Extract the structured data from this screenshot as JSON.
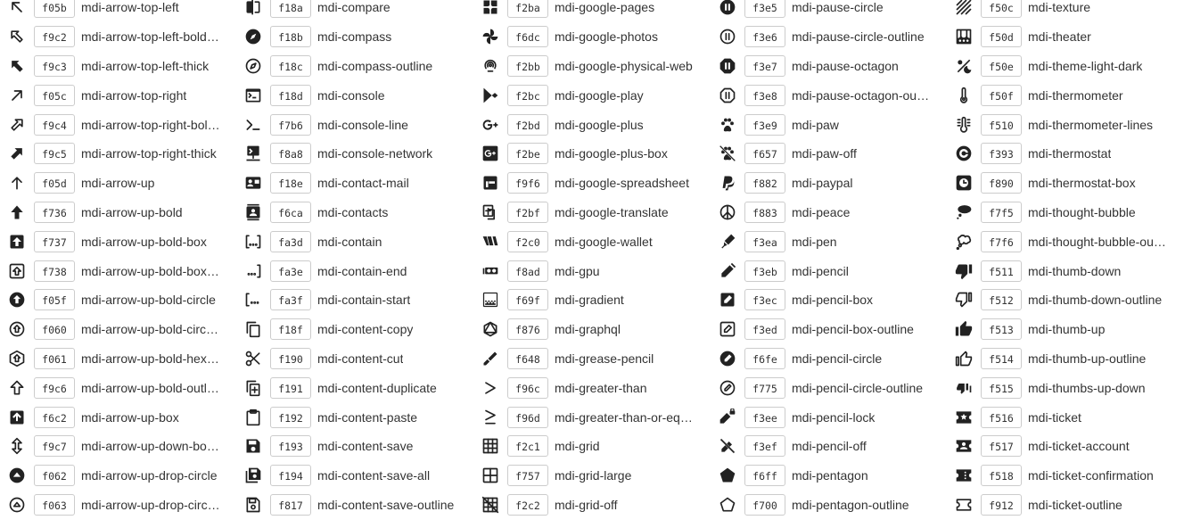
{
  "columns": [
    [
      {
        "icon": "arrow-top-left",
        "code": "f05b",
        "name": "mdi-arrow-top-left"
      },
      {
        "icon": "arrow-top-left-bold-outline",
        "code": "f9c2",
        "name": "mdi-arrow-top-left-bold…"
      },
      {
        "icon": "arrow-top-left-thick",
        "code": "f9c3",
        "name": "mdi-arrow-top-left-thick"
      },
      {
        "icon": "arrow-top-right",
        "code": "f05c",
        "name": "mdi-arrow-top-right"
      },
      {
        "icon": "arrow-top-right-bold-outline",
        "code": "f9c4",
        "name": "mdi-arrow-top-right-bol…"
      },
      {
        "icon": "arrow-top-right-thick",
        "code": "f9c5",
        "name": "mdi-arrow-top-right-thick"
      },
      {
        "icon": "arrow-up",
        "code": "f05d",
        "name": "mdi-arrow-up"
      },
      {
        "icon": "arrow-up-bold",
        "code": "f736",
        "name": "mdi-arrow-up-bold"
      },
      {
        "icon": "arrow-up-bold-box",
        "code": "f737",
        "name": "mdi-arrow-up-bold-box"
      },
      {
        "icon": "arrow-up-bold-box-outline",
        "code": "f738",
        "name": "mdi-arrow-up-bold-box…"
      },
      {
        "icon": "arrow-up-bold-circle",
        "code": "f05f",
        "name": "mdi-arrow-up-bold-circle"
      },
      {
        "icon": "arrow-up-bold-circle-outline",
        "code": "f060",
        "name": "mdi-arrow-up-bold-circ…"
      },
      {
        "icon": "arrow-up-bold-hexagon",
        "code": "f061",
        "name": "mdi-arrow-up-bold-hex…"
      },
      {
        "icon": "arrow-up-bold-outline",
        "code": "f9c6",
        "name": "mdi-arrow-up-bold-outl…"
      },
      {
        "icon": "arrow-up-box",
        "code": "f6c2",
        "name": "mdi-arrow-up-box"
      },
      {
        "icon": "arrow-up-down-bold",
        "code": "f9c7",
        "name": "mdi-arrow-up-down-bo…"
      },
      {
        "icon": "arrow-up-drop-circle",
        "code": "f062",
        "name": "mdi-arrow-up-drop-circle"
      },
      {
        "icon": "arrow-up-drop-circle-outline",
        "code": "f063",
        "name": "mdi-arrow-up-drop-circ…"
      }
    ],
    [
      {
        "icon": "compare",
        "code": "f18a",
        "name": "mdi-compare"
      },
      {
        "icon": "compass",
        "code": "f18b",
        "name": "mdi-compass"
      },
      {
        "icon": "compass-outline",
        "code": "f18c",
        "name": "mdi-compass-outline"
      },
      {
        "icon": "console",
        "code": "f18d",
        "name": "mdi-console"
      },
      {
        "icon": "console-line",
        "code": "f7b6",
        "name": "mdi-console-line"
      },
      {
        "icon": "console-network",
        "code": "f8a8",
        "name": "mdi-console-network"
      },
      {
        "icon": "contact-mail",
        "code": "f18e",
        "name": "mdi-contact-mail"
      },
      {
        "icon": "contacts",
        "code": "f6ca",
        "name": "mdi-contacts"
      },
      {
        "icon": "contain",
        "code": "fa3d",
        "name": "mdi-contain"
      },
      {
        "icon": "contain-end",
        "code": "fa3e",
        "name": "mdi-contain-end"
      },
      {
        "icon": "contain-start",
        "code": "fa3f",
        "name": "mdi-contain-start"
      },
      {
        "icon": "content-copy",
        "code": "f18f",
        "name": "mdi-content-copy"
      },
      {
        "icon": "content-cut",
        "code": "f190",
        "name": "mdi-content-cut"
      },
      {
        "icon": "content-duplicate",
        "code": "f191",
        "name": "mdi-content-duplicate"
      },
      {
        "icon": "content-paste",
        "code": "f192",
        "name": "mdi-content-paste"
      },
      {
        "icon": "content-save",
        "code": "f193",
        "name": "mdi-content-save"
      },
      {
        "icon": "content-save-all",
        "code": "f194",
        "name": "mdi-content-save-all"
      },
      {
        "icon": "content-save-outline",
        "code": "f817",
        "name": "mdi-content-save-outline"
      }
    ],
    [
      {
        "icon": "google-pages",
        "code": "f2ba",
        "name": "mdi-google-pages"
      },
      {
        "icon": "google-photos",
        "code": "f6dc",
        "name": "mdi-google-photos"
      },
      {
        "icon": "google-physical-web",
        "code": "f2bb",
        "name": "mdi-google-physical-web"
      },
      {
        "icon": "google-play",
        "code": "f2bc",
        "name": "mdi-google-play"
      },
      {
        "icon": "google-plus",
        "code": "f2bd",
        "name": "mdi-google-plus"
      },
      {
        "icon": "google-plus-box",
        "code": "f2be",
        "name": "mdi-google-plus-box"
      },
      {
        "icon": "google-spreadsheet",
        "code": "f9f6",
        "name": "mdi-google-spreadsheet"
      },
      {
        "icon": "google-translate",
        "code": "f2bf",
        "name": "mdi-google-translate"
      },
      {
        "icon": "google-wallet",
        "code": "f2c0",
        "name": "mdi-google-wallet"
      },
      {
        "icon": "gpu",
        "code": "f8ad",
        "name": "mdi-gpu"
      },
      {
        "icon": "gradient",
        "code": "f69f",
        "name": "mdi-gradient"
      },
      {
        "icon": "graphql",
        "code": "f876",
        "name": "mdi-graphql"
      },
      {
        "icon": "grease-pencil",
        "code": "f648",
        "name": "mdi-grease-pencil"
      },
      {
        "icon": "greater-than",
        "code": "f96c",
        "name": "mdi-greater-than"
      },
      {
        "icon": "greater-than-or-equal",
        "code": "f96d",
        "name": "mdi-greater-than-or-eq…"
      },
      {
        "icon": "grid",
        "code": "f2c1",
        "name": "mdi-grid"
      },
      {
        "icon": "grid-large",
        "code": "f757",
        "name": "mdi-grid-large"
      },
      {
        "icon": "grid-off",
        "code": "f2c2",
        "name": "mdi-grid-off"
      }
    ],
    [
      {
        "icon": "pause-circle",
        "code": "f3e5",
        "name": "mdi-pause-circle"
      },
      {
        "icon": "pause-circle-outline",
        "code": "f3e6",
        "name": "mdi-pause-circle-outline"
      },
      {
        "icon": "pause-octagon",
        "code": "f3e7",
        "name": "mdi-pause-octagon"
      },
      {
        "icon": "pause-octagon-outline",
        "code": "f3e8",
        "name": "mdi-pause-octagon-ou…"
      },
      {
        "icon": "paw",
        "code": "f3e9",
        "name": "mdi-paw"
      },
      {
        "icon": "paw-off",
        "code": "f657",
        "name": "mdi-paw-off"
      },
      {
        "icon": "paypal",
        "code": "f882",
        "name": "mdi-paypal"
      },
      {
        "icon": "peace",
        "code": "f883",
        "name": "mdi-peace"
      },
      {
        "icon": "pen",
        "code": "f3ea",
        "name": "mdi-pen"
      },
      {
        "icon": "pencil",
        "code": "f3eb",
        "name": "mdi-pencil"
      },
      {
        "icon": "pencil-box",
        "code": "f3ec",
        "name": "mdi-pencil-box"
      },
      {
        "icon": "pencil-box-outline",
        "code": "f3ed",
        "name": "mdi-pencil-box-outline"
      },
      {
        "icon": "pencil-circle",
        "code": "f6fe",
        "name": "mdi-pencil-circle"
      },
      {
        "icon": "pencil-circle-outline",
        "code": "f775",
        "name": "mdi-pencil-circle-outline"
      },
      {
        "icon": "pencil-lock",
        "code": "f3ee",
        "name": "mdi-pencil-lock"
      },
      {
        "icon": "pencil-off",
        "code": "f3ef",
        "name": "mdi-pencil-off"
      },
      {
        "icon": "pentagon",
        "code": "f6ff",
        "name": "mdi-pentagon"
      },
      {
        "icon": "pentagon-outline",
        "code": "f700",
        "name": "mdi-pentagon-outline"
      }
    ],
    [
      {
        "icon": "texture",
        "code": "f50c",
        "name": "mdi-texture"
      },
      {
        "icon": "theater",
        "code": "f50d",
        "name": "mdi-theater"
      },
      {
        "icon": "theme-light-dark",
        "code": "f50e",
        "name": "mdi-theme-light-dark"
      },
      {
        "icon": "thermometer",
        "code": "f50f",
        "name": "mdi-thermometer"
      },
      {
        "icon": "thermometer-lines",
        "code": "f510",
        "name": "mdi-thermometer-lines"
      },
      {
        "icon": "thermostat",
        "code": "f393",
        "name": "mdi-thermostat"
      },
      {
        "icon": "thermostat-box",
        "code": "f890",
        "name": "mdi-thermostat-box"
      },
      {
        "icon": "thought-bubble",
        "code": "f7f5",
        "name": "mdi-thought-bubble"
      },
      {
        "icon": "thought-bubble-outline",
        "code": "f7f6",
        "name": "mdi-thought-bubble-ou…"
      },
      {
        "icon": "thumb-down",
        "code": "f511",
        "name": "mdi-thumb-down"
      },
      {
        "icon": "thumb-down-outline",
        "code": "f512",
        "name": "mdi-thumb-down-outline"
      },
      {
        "icon": "thumb-up",
        "code": "f513",
        "name": "mdi-thumb-up"
      },
      {
        "icon": "thumb-up-outline",
        "code": "f514",
        "name": "mdi-thumb-up-outline"
      },
      {
        "icon": "thumbs-up-down",
        "code": "f515",
        "name": "mdi-thumbs-up-down"
      },
      {
        "icon": "ticket",
        "code": "f516",
        "name": "mdi-ticket"
      },
      {
        "icon": "ticket-account",
        "code": "f517",
        "name": "mdi-ticket-account"
      },
      {
        "icon": "ticket-confirmation",
        "code": "f518",
        "name": "mdi-ticket-confirmation"
      },
      {
        "icon": "ticket-outline",
        "code": "f912",
        "name": "mdi-ticket-outline"
      }
    ]
  ]
}
